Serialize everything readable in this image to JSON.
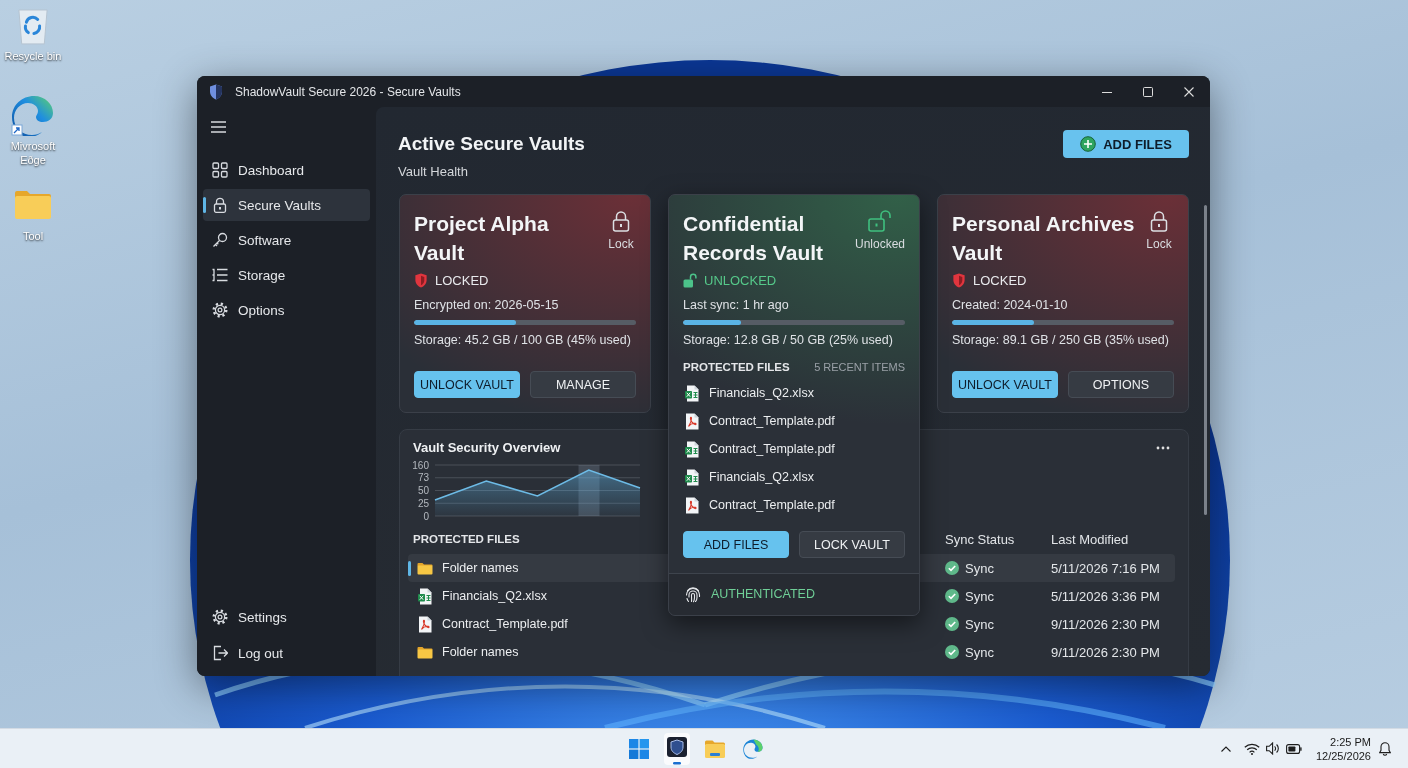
{
  "desktop": {
    "icons": [
      {
        "label": "Resycle bin",
        "kind": "bin"
      },
      {
        "label": "Mivrosoft Eðge",
        "kind": "edge"
      },
      {
        "label": "Tool",
        "kind": "folder"
      }
    ]
  },
  "window": {
    "title": "ShadowVault Secure 2026 - Secure Vaults"
  },
  "sidebar": {
    "items": [
      {
        "label": "Dashboard",
        "selected": false
      },
      {
        "label": "Secure Vaults",
        "selected": true
      },
      {
        "label": "Software",
        "selected": false
      },
      {
        "label": "Storage",
        "selected": false
      },
      {
        "label": "Options",
        "selected": false
      }
    ],
    "footer_items": [
      {
        "label": "Settings",
        "selected": false
      },
      {
        "label": "Log out",
        "selected": false
      }
    ]
  },
  "header": {
    "title": "Active Secure Vaults",
    "subtitle": "Vault Health",
    "add_button": "ADD FILES"
  },
  "vaults": [
    {
      "title": "Project Alpha Vault",
      "locked": true,
      "lock_label": "Lock",
      "status": "LOCKED",
      "info": "Encrypted on: 2026-05-15",
      "level": 0.46,
      "storage": "Storage: 45.2 GB / 100 GB (45% used)",
      "expanded": false,
      "buttons": [
        {
          "label": "UNLOCK VAULT",
          "primary": true
        },
        {
          "label": "MANAGE",
          "primary": false
        }
      ]
    },
    {
      "title": "Confidential Records Vault",
      "locked": false,
      "lock_label": "Unlocked",
      "status": "UNLOCKED",
      "info": "Last sync: 1 hr ago",
      "level": 0.26,
      "storage": "Storage: 12.8 GB / 50 GB (25% used)",
      "expanded": true,
      "files_label": "PROTECTED FILES",
      "files_count": "5 RECENT ITEMS",
      "files": [
        {
          "name": "Financials_Q2.xlsx",
          "kind": "xlsx"
        },
        {
          "name": "Contract_Template.pdf",
          "kind": "pdf"
        },
        {
          "name": "Contract_Template.pdf",
          "kind": "xlsx"
        },
        {
          "name": "Financials_Q2.xlsx",
          "kind": "xlsx"
        },
        {
          "name": "Contract_Template.pdf",
          "kind": "pdf"
        }
      ],
      "buttons": [
        {
          "label": "ADD FILES",
          "primary": true
        },
        {
          "label": "LOCK VAULT",
          "primary": false
        }
      ],
      "auth": "AUTHENTICATED"
    },
    {
      "title": "Personal Archives Vault",
      "locked": true,
      "lock_label": "Lock",
      "status": "LOCKED",
      "info": "Created: 2024-01-10",
      "level": 0.37,
      "storage": "Storage: 89.1 GB / 250 GB (35% used)",
      "expanded": false,
      "buttons": [
        {
          "label": "UNLOCK VAULT",
          "primary": true
        },
        {
          "label": "OPTIONS",
          "primary": false
        }
      ]
    }
  ],
  "overview": {
    "title": "Vault Security Overview",
    "chart_labels": [
      "160",
      "73",
      "50",
      "25",
      "0"
    ],
    "table": {
      "label": "PROTECTED FILES",
      "columns": [
        "Sync Status",
        "Last Modified"
      ],
      "rows": [
        {
          "name": "Folder names",
          "kind": "folder",
          "sync": "Sync",
          "modified": "5/11/2026 7:16 PM",
          "selected": true
        },
        {
          "name": "Financials_Q2.xlsx",
          "kind": "xlsx",
          "sync": "Sync",
          "modified": "5/11/2026 3:36 PM",
          "selected": false
        },
        {
          "name": "Contract_Template.pdf",
          "kind": "pdf",
          "sync": "Sync",
          "modified": "9/11/2026 2:30 PM",
          "selected": false
        },
        {
          "name": "Folder names",
          "kind": "folder",
          "sync": "Sync",
          "modified": "9/11/2026 2:30 PM",
          "selected": false
        }
      ]
    }
  },
  "taskbar": {
    "apps": [
      {
        "kind": "start",
        "selected": false
      },
      {
        "kind": "vault",
        "selected": true
      },
      {
        "kind": "folder",
        "selected": false
      },
      {
        "kind": "edge",
        "selected": false
      }
    ],
    "time": "2:25 PM",
    "date": "12/25/2026"
  }
}
